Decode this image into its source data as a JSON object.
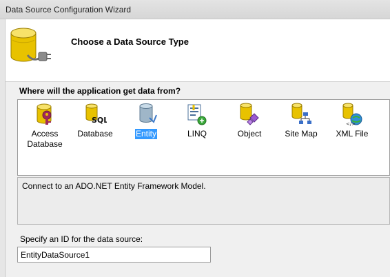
{
  "window": {
    "title": "Data Source Configuration Wizard"
  },
  "header": {
    "title": "Choose a Data Source Type",
    "icon": "database-plug-icon"
  },
  "question": "Where will the application get data from?",
  "types": [
    {
      "label": "Access Database",
      "icon": "access-database-icon",
      "selected": false
    },
    {
      "label": "Database",
      "icon": "sql-database-icon",
      "selected": false
    },
    {
      "label": "Entity",
      "icon": "entity-icon",
      "selected": true
    },
    {
      "label": "LINQ",
      "icon": "linq-icon",
      "selected": false
    },
    {
      "label": "Object",
      "icon": "object-icon",
      "selected": false
    },
    {
      "label": "Site Map",
      "icon": "site-map-icon",
      "selected": false
    },
    {
      "label": "XML File",
      "icon": "xml-file-icon",
      "selected": false
    }
  ],
  "description": "Connect to an ADO.NET Entity Framework Model.",
  "id_field": {
    "label": "Specify an ID for the data source:",
    "value": "EntityDataSource1"
  },
  "colors": {
    "selection": "#3399ff",
    "database_yellow": "#f2c400"
  }
}
